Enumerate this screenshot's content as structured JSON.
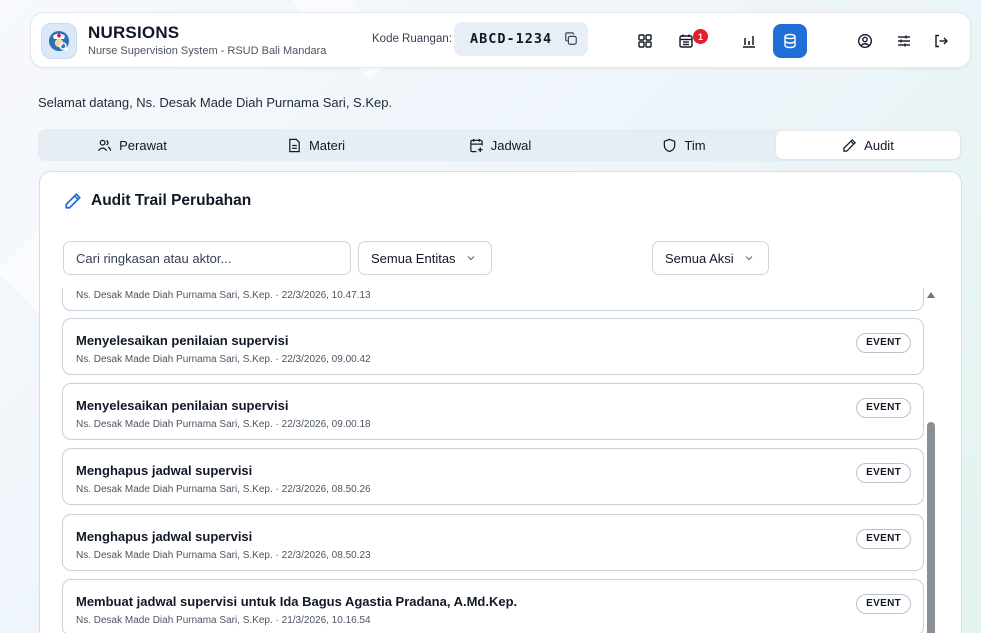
{
  "app": {
    "title": "NURSIONS",
    "subtitle": "Nurse Supervision System - RSUD Bali Mandara"
  },
  "room": {
    "label": "Kode Ruangan:",
    "code": "ABCD-1234"
  },
  "header_icons": [
    {
      "name": "dashboard-grid-icon",
      "active": false
    },
    {
      "name": "calendar-icon",
      "active": false,
      "badge": "1"
    },
    {
      "name": "bar-chart-icon",
      "active": false
    },
    {
      "name": "database-icon",
      "active": true
    },
    {
      "name": "user-circle-icon",
      "active": false
    },
    {
      "name": "sliders-icon",
      "active": false
    },
    {
      "name": "logout-icon",
      "active": false
    }
  ],
  "welcome": "Selamat datang, Ns. Desak Made Diah Purnama Sari, S.Kep.",
  "tabs": [
    {
      "label": "Perawat",
      "icon": "users-icon"
    },
    {
      "label": "Materi",
      "icon": "document-icon"
    },
    {
      "label": "Jadwal",
      "icon": "calendar-plus-icon"
    },
    {
      "label": "Tim",
      "icon": "shield-icon"
    },
    {
      "label": "Audit",
      "icon": "pencil-icon",
      "active": true
    }
  ],
  "panel": {
    "title": "Audit Trail Perubahan",
    "search_placeholder": "Cari ringkasan atau aktor...",
    "entity_filter": "Semua Entitas",
    "action_filter": "Semua Aksi"
  },
  "audit_items": [
    {
      "title": "",
      "meta": "Ns. Desak Made Diah Purnama Sari, S.Kep. · 22/3/2026, 10.47.13",
      "badge": ""
    },
    {
      "title": "Menyelesaikan penilaian supervisi",
      "meta": "Ns. Desak Made Diah Purnama Sari, S.Kep. · 22/3/2026, 09.00.42",
      "badge": "EVENT"
    },
    {
      "title": "Menyelesaikan penilaian supervisi",
      "meta": "Ns. Desak Made Diah Purnama Sari, S.Kep. · 22/3/2026, 09.00.18",
      "badge": "EVENT"
    },
    {
      "title": "Menghapus jadwal supervisi",
      "meta": "Ns. Desak Made Diah Purnama Sari, S.Kep. · 22/3/2026, 08.50.26",
      "badge": "EVENT"
    },
    {
      "title": "Menghapus jadwal supervisi",
      "meta": "Ns. Desak Made Diah Purnama Sari, S.Kep. · 22/3/2026, 08.50.23",
      "badge": "EVENT"
    },
    {
      "title": "Membuat jadwal supervisi untuk Ida Bagus Agastia Pradana, A.Md.Kep.",
      "meta": "Ns. Desak Made Diah Purnama Sari, S.Kep. · 21/3/2026, 10.16.54",
      "badge": "EVENT"
    }
  ],
  "colors": {
    "accent": "#1f6fd6",
    "badge_red": "#e11d2e"
  }
}
